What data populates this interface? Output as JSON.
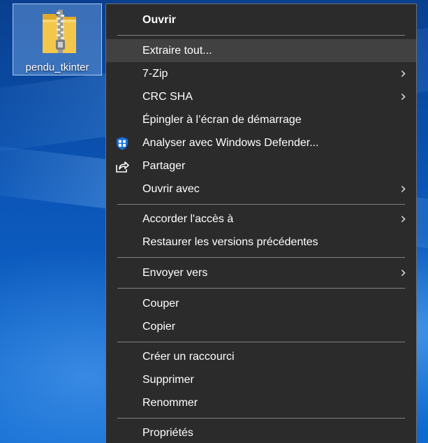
{
  "desktop": {
    "icon_label": "pendu_tkinter",
    "icon_name": "zip-folder-icon"
  },
  "menu": {
    "items": [
      {
        "label": "Ouvrir",
        "bold": true
      },
      {
        "label": "Extraire tout...",
        "highlighted": true
      },
      {
        "label": "7-Zip",
        "submenu": true
      },
      {
        "label": "CRC SHA",
        "submenu": true
      },
      {
        "label": "Épingler à l’écran de démarrage"
      },
      {
        "label": "Analyser avec Windows Defender...",
        "icon": "windows-defender-shield-icon"
      },
      {
        "label": "Partager",
        "icon": "share-icon"
      },
      {
        "label": "Ouvrir avec",
        "submenu": true
      },
      {
        "label": "Accorder l'accès à",
        "submenu": true
      },
      {
        "label": "Restaurer les versions précédentes"
      },
      {
        "label": "Envoyer vers",
        "submenu": true
      },
      {
        "label": "Couper"
      },
      {
        "label": "Copier"
      },
      {
        "label": "Créer un raccourci"
      },
      {
        "label": "Supprimer"
      },
      {
        "label": "Renommer"
      },
      {
        "label": "Propriétés"
      }
    ],
    "submenu_arrow": "›"
  },
  "colors": {
    "menu_background": "#2b2b2b",
    "menu_highlight": "#414141",
    "defender_blue": "#1a6fd6",
    "folder_yellow": "#f3c64c"
  }
}
